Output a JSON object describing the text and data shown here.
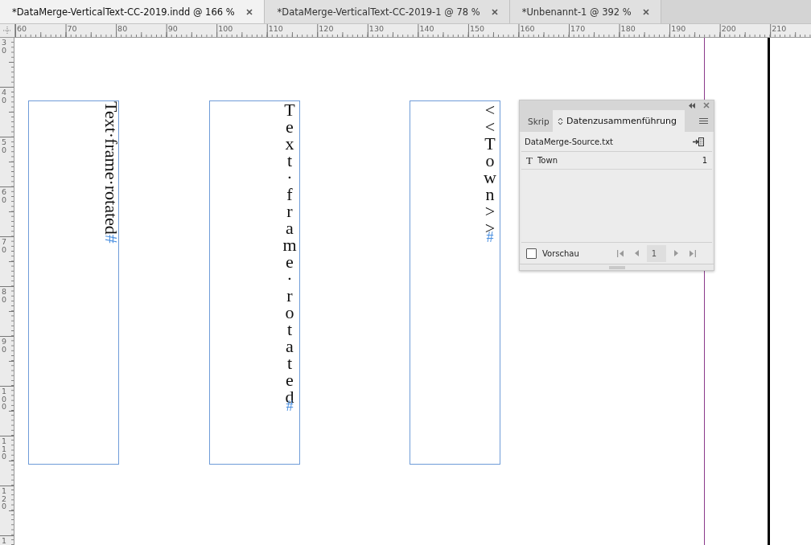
{
  "tabs": [
    {
      "label": "*DataMerge-VerticalText-CC-2019.indd @ 166 %",
      "selected": true
    },
    {
      "label": "*DataMerge-VerticalText-CC-2019-1 @ 78 %",
      "selected": false
    },
    {
      "label": "*Unbenannt-1 @ 392 %",
      "selected": false
    }
  ],
  "horizontal_ruler": {
    "labels": [
      "60",
      "70",
      "80",
      "90",
      "100",
      "110",
      "120",
      "130",
      "140",
      "150",
      "160",
      "170",
      "180",
      "190",
      "200",
      "210"
    ]
  },
  "vertical_ruler": {
    "labels": [
      "30",
      "40",
      "50",
      "60",
      "70",
      "80",
      "90",
      "100",
      "110",
      "120",
      "1"
    ]
  },
  "frames": [
    {
      "kind": "rotated",
      "text": "Text·frame·rotated",
      "end_mark": "#"
    },
    {
      "kind": "stacked",
      "text": "Text·frame·rotated",
      "end_mark": "#"
    },
    {
      "kind": "stacked",
      "text": "<<Town>>",
      "end_mark": "#"
    }
  ],
  "panel": {
    "tabs": [
      {
        "label": "Skrip",
        "selected": false
      },
      {
        "label": "Datenzusammenführung",
        "selected": true
      }
    ],
    "source": "DataMerge-Source.txt",
    "fields": [
      {
        "type_icon": "T",
        "name": "Town",
        "count": "1"
      }
    ],
    "preview": {
      "label": "Vorschau",
      "checked": false
    },
    "record": "1"
  }
}
